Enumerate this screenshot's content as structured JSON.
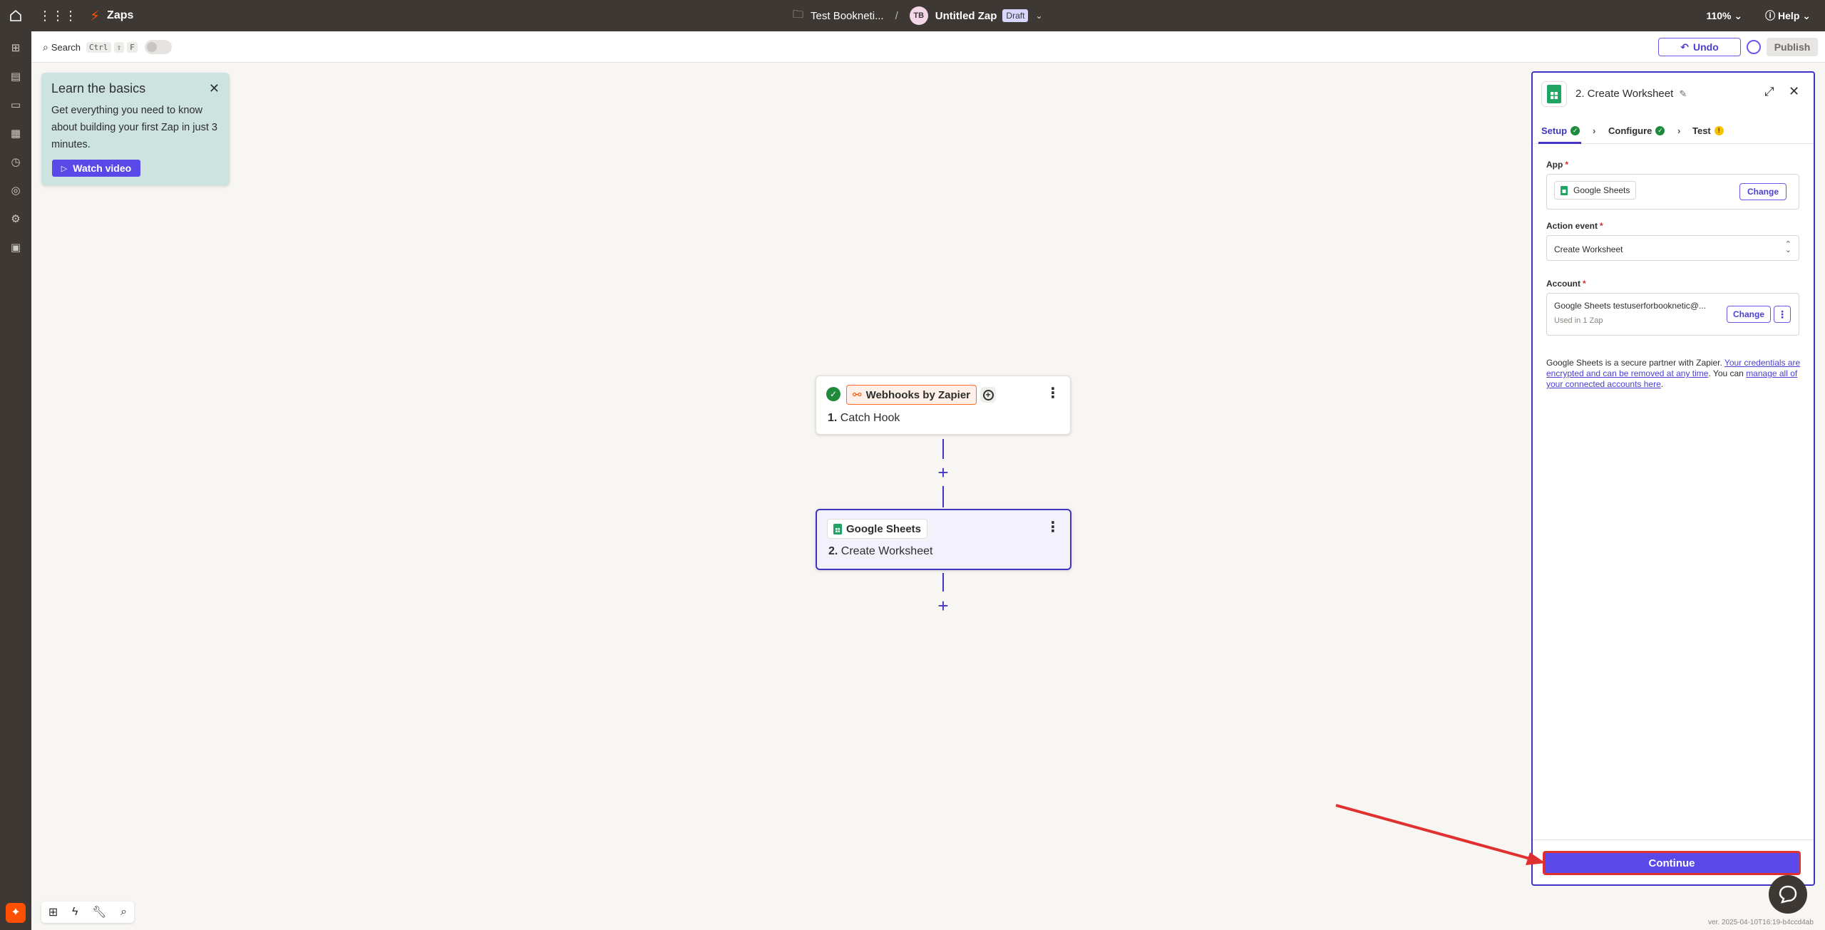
{
  "topbar": {
    "app_name": "Zaps",
    "folder": "Test Bookneti...",
    "separator": "/",
    "avatar_initials": "TB",
    "zap_name": "Untitled Zap",
    "status_badge": "Draft",
    "zoom": "110%",
    "help": "Help"
  },
  "subbar": {
    "search_label": "Search",
    "shortcut_ctrl": "Ctrl",
    "shortcut_shift": "⇧",
    "shortcut_f": "F",
    "undo": "Undo",
    "publish": "Publish"
  },
  "learn": {
    "title": "Learn the basics",
    "body": "Get everything you need to know about building your first Zap in just 3 minutes.",
    "watch": "Watch video"
  },
  "steps": [
    {
      "app": "Webhooks by Zapier",
      "number": "1.",
      "title": "Catch Hook"
    },
    {
      "app": "Google Sheets",
      "number": "2.",
      "title": "Create Worksheet"
    }
  ],
  "panel": {
    "title": "2. Create Worksheet",
    "tabs": {
      "setup": "Setup",
      "configure": "Configure",
      "test": "Test"
    },
    "app_label": "App",
    "app_value": "Google Sheets",
    "change": "Change",
    "event_label": "Action event",
    "event_value": "Create Worksheet",
    "account_label": "Account",
    "account_value": "Google Sheets testuserforbooknetic@...",
    "account_used": "Used in 1 Zap",
    "required_mark": "*",
    "secure_text_1": "Google Sheets is a secure partner with Zapier. ",
    "secure_link_1": "Your credentials are encrypted and can be removed at any time",
    "secure_text_2": ". You can ",
    "secure_link_2": "manage all of your connected accounts here",
    "secure_text_3": ".",
    "continue": "Continue"
  },
  "footer": {
    "version": "ver. 2025-04-10T16:19-b4ccd4ab"
  },
  "colors": {
    "brand_orange": "#ff4f00",
    "primary": "#5a48e8",
    "topbar": "#3d3833",
    "annotation_red": "#e03131"
  }
}
